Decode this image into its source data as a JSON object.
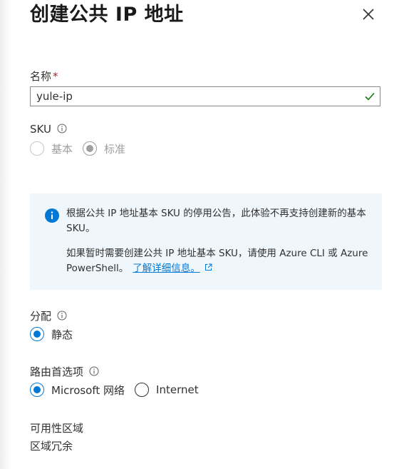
{
  "panel": {
    "title": "创建公共 IP 地址"
  },
  "name_field": {
    "label": "名称",
    "required_mark": "*",
    "value": "yule-ip"
  },
  "sku": {
    "label": "SKU",
    "options": [
      {
        "label": "基本",
        "selected": false,
        "disabled": true
      },
      {
        "label": "标准",
        "selected": true,
        "disabled": true
      }
    ]
  },
  "info_message": {
    "line1": "根据公共 IP 地址基本 SKU 的停用公告，此体验不再支持创建新的基本 SKU。",
    "line2": "如果暂时需要创建公共 IP 地址基本 SKU，请使用 Azure CLI 或 Azure PowerShell。",
    "link_text": "了解详细信息。"
  },
  "assignment": {
    "label": "分配",
    "options": [
      {
        "label": "静态",
        "selected": true
      }
    ]
  },
  "routing_preference": {
    "label": "路由首选项",
    "options": [
      {
        "label": "Microsoft 网络",
        "selected": true
      },
      {
        "label": "Internet",
        "selected": false
      }
    ]
  },
  "availability_zone": {
    "label": "可用性区域",
    "value": "区域冗余"
  },
  "colors": {
    "accent": "#0078d4",
    "required": "#a4262c",
    "valid": "#107c10",
    "info_background": "#eff6fc"
  }
}
